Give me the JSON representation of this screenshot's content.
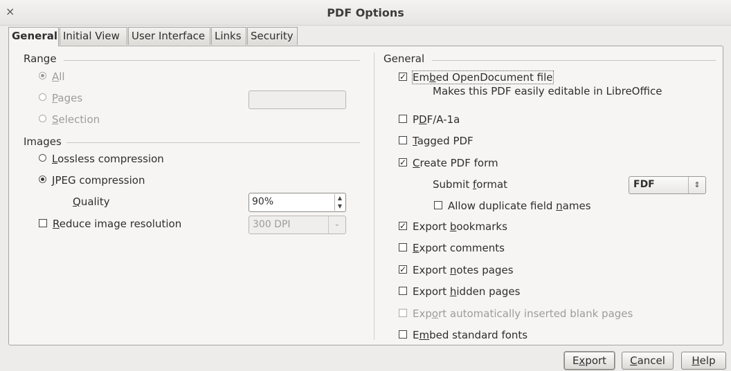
{
  "window": {
    "title": "PDF Options",
    "close_glyph": "×"
  },
  "tabs": [
    {
      "label": "General",
      "active": true
    },
    {
      "label": "Initial View",
      "active": false
    },
    {
      "label": "User Interface",
      "active": false
    },
    {
      "label": "Links",
      "active": false
    },
    {
      "label": "Security",
      "active": false
    }
  ],
  "range": {
    "heading": "Range",
    "all": {
      "label": "All",
      "selected": true
    },
    "pages": {
      "label": "Pages",
      "selected": false,
      "value": ""
    },
    "selection": {
      "label": "Selection",
      "selected": false
    }
  },
  "images": {
    "heading": "Images",
    "lossless": {
      "label": "Lossless compression",
      "selected": false
    },
    "jpeg": {
      "label": "JPEG compression",
      "selected": true
    },
    "quality": {
      "label": "Quality",
      "value": "90%"
    },
    "reduce": {
      "label": "Reduce image resolution",
      "checked": false,
      "value": "300 DPI"
    }
  },
  "general": {
    "heading": "General",
    "embed_odf": {
      "label": "Embed OpenDocument file",
      "checked": true,
      "note": "Makes this PDF easily editable in LibreOffice"
    },
    "pdfa": {
      "label": "PDF/A-1a",
      "checked": false
    },
    "tagged": {
      "label": "Tagged PDF",
      "checked": false
    },
    "create_form": {
      "label": "Create PDF form",
      "checked": true
    },
    "submit_format": {
      "label": "Submit format",
      "value": "FDF"
    },
    "allow_dup": {
      "label": "Allow duplicate field names",
      "checked": false
    },
    "bookmarks": {
      "label": "Export bookmarks",
      "checked": true
    },
    "comments": {
      "label": "Export comments",
      "checked": false
    },
    "notes": {
      "label": "Export notes pages",
      "checked": true
    },
    "hidden": {
      "label": "Export hidden pages",
      "checked": false
    },
    "auto_blank": {
      "label": "Export automatically inserted blank pages",
      "checked": false
    },
    "std_fonts": {
      "label": "Embed standard fonts",
      "checked": false
    }
  },
  "buttons": {
    "export": "Export",
    "cancel": "Cancel",
    "help": "Help"
  }
}
